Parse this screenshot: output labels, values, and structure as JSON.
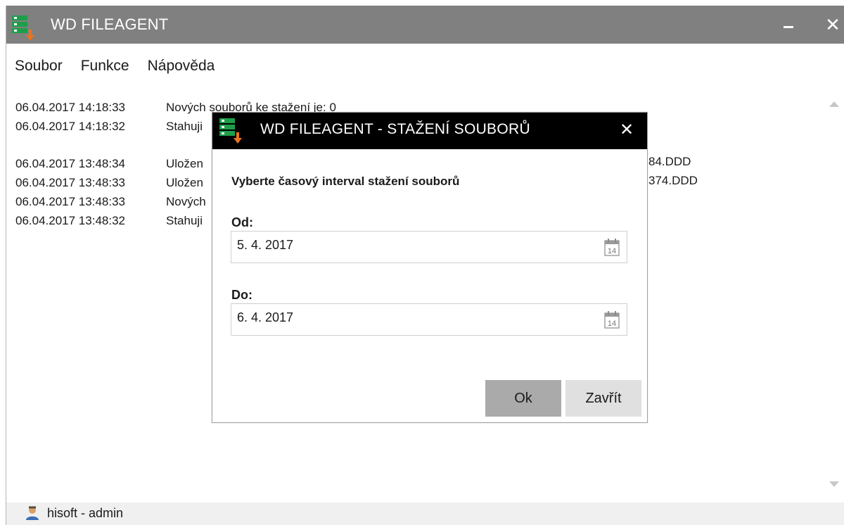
{
  "window": {
    "title": "WD FILEAGENT",
    "close_glyph": "✕"
  },
  "menu": {
    "items": [
      {
        "label": "Soubor"
      },
      {
        "label": "Funkce"
      },
      {
        "label": "Nápověda"
      }
    ]
  },
  "log": {
    "entries": [
      {
        "time": "06.04.2017 14:18:33",
        "message": "Nových souborů ke stažení je: 0"
      },
      {
        "time": "06.04.2017 14:18:32",
        "message": "Stahuji"
      },
      {
        "time": "06.04.2017 13:48:34",
        "message": "Uložen",
        "tail": "84.DDD"
      },
      {
        "time": "06.04.2017 13:48:33",
        "message": "Uložen",
        "tail": "374.DDD"
      },
      {
        "time": "06.04.2017 13:48:33",
        "message": "Nových"
      },
      {
        "time": "06.04.2017 13:48:32",
        "message": "Stahuji"
      }
    ]
  },
  "status": {
    "user": "hisoft - admin"
  },
  "dialog": {
    "title": "WD FILEAGENT - STAŽENÍ SOUBORŮ",
    "close_glyph": "✕",
    "prompt": "Vyberte časový interval stažení souborů",
    "from_label": "Od:",
    "from_value": "5. 4. 2017",
    "to_label": "Do:",
    "to_value": "6. 4. 2017",
    "calendar_day": "14",
    "ok_label": "Ok",
    "close_label": "Zavřít"
  },
  "colors": {
    "titlebar": "#808080",
    "dialog_titlebar": "#000000",
    "icon_green": "#1e9e4a",
    "icon_orange": "#e8731c",
    "ok_button": "#aaaaaa",
    "close_button": "#e0e0e0"
  },
  "icons": {
    "app": "server-download-icon",
    "user": "user-icon",
    "calendar": "calendar-icon"
  }
}
